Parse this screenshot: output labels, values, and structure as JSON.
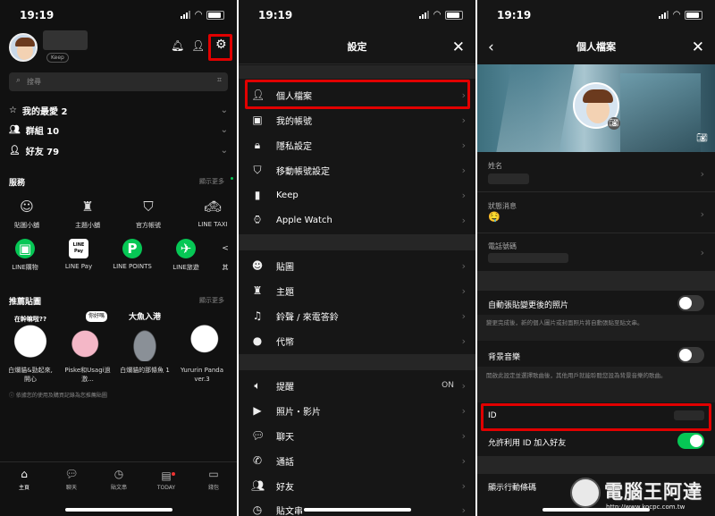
{
  "time": "19:19",
  "home": {
    "keep_badge": "Keep",
    "search_placeholder": "搜尋",
    "rows": [
      "我的最愛 2",
      "群組 10",
      "好友 79"
    ],
    "services_title": "服務",
    "show_more": "顯示更多",
    "services": [
      "貼圖小舖",
      "主題小舖",
      "官方帳號",
      "LINE TAXI",
      "LINE購物",
      "LINE Pay",
      "LINE POINTS",
      "LINE旅遊",
      "其"
    ],
    "line_pay_logo": "LINE Pay",
    "stickers_title": "推薦貼圖",
    "stickers": [
      "白爛貓&勁起來,開心",
      "Piske和Usagi過激...",
      "白爛貓的那條魚 1",
      "Yururin Panda ver.3"
    ],
    "sticker_texts": [
      "在幹嘛啦??",
      "你好嗎",
      "大魚入港"
    ],
    "stickers_note": "ⓘ 依據您的使用及購買記錄為您推薦貼圖",
    "tabs": [
      "主頁",
      "聊天",
      "貼文串",
      "TODAY",
      "錢包"
    ]
  },
  "settings": {
    "title": "設定",
    "group1": [
      "個人檔案",
      "我的帳號",
      "隱私設定",
      "移動帳號設定",
      "Keep",
      "Apple Watch"
    ],
    "group2": [
      "貼圖",
      "主題",
      "鈴聲 / 來電答鈴",
      "代幣"
    ],
    "group3": [
      "提醒",
      "照片・影片",
      "聊天",
      "通話",
      "好友",
      "貼文串"
    ],
    "reminder_value": "ON"
  },
  "profile": {
    "title": "個人檔案",
    "name_label": "姓名",
    "status_label": "狀態消息",
    "phone_label": "電話號碼",
    "auto_post_label": "自動張貼變更後的照片",
    "auto_post_desc": "變更完成後，新的個人圖片或封面照片將自動張貼至貼文串。",
    "bgm_label": "背景音樂",
    "bgm_desc": "開啟此設定並選擇歌曲後，其他用戶就能聆聽您設為背景音樂的歌曲。",
    "id_label": "ID",
    "allow_id_label": "允許利用 ID 加入好友",
    "qr_label": "顯示行動條碼"
  },
  "watermark": {
    "name": "電腦王阿達",
    "url": "http://www.kocpc.com.tw"
  },
  "colors": {
    "accent": "#06c755",
    "highlight": "#e10000"
  }
}
